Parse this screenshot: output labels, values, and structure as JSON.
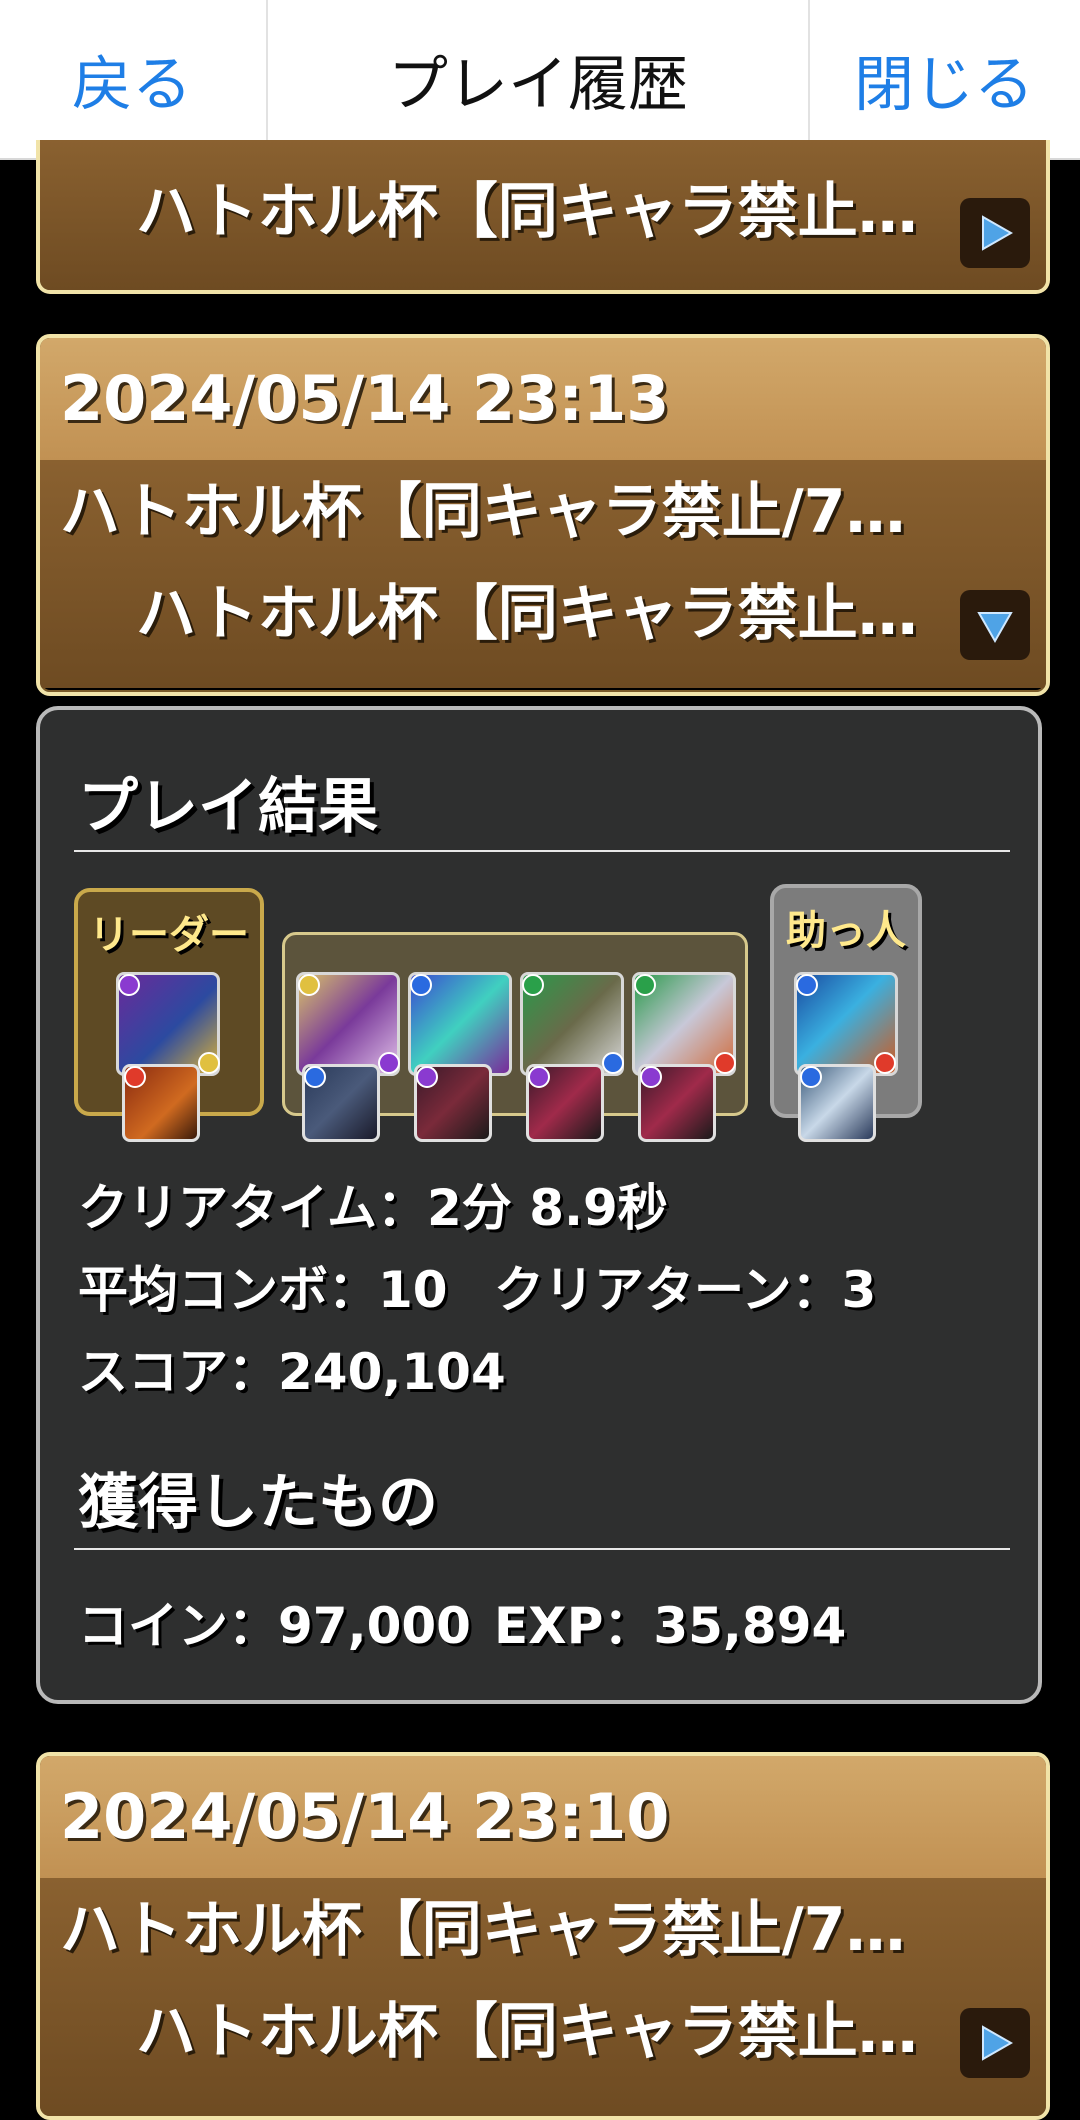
{
  "nav": {
    "back": "戻る",
    "title": "プレイ履歴",
    "close": "閉じる"
  },
  "entries": [
    {
      "subtitle": "ハトホル杯【同キャラ禁止…",
      "toggle": "expand-icon"
    },
    {
      "date": "2024/05/14 23:13",
      "title": "ハトホル杯【同キャラ禁止/7…",
      "subtitle": "ハトホル杯【同キャラ禁止…",
      "toggle": "collapse-icon"
    },
    {
      "date": "2024/05/14 23:10",
      "title": "ハトホル杯【同キャラ禁止/7…",
      "subtitle": "ハトホル杯【同キャラ禁止…",
      "toggle": "expand-icon"
    }
  ],
  "result": {
    "title": "プレイ結果",
    "leader_label": "リーダー",
    "helper_label": "助っ人",
    "clear_time": "クリアタイム：2分 8.9秒",
    "avg_combo": "平均コンボ：10",
    "clear_turns": "クリアターン：3",
    "score": "スコア：240,104"
  },
  "rewards": {
    "title": "獲得したもの",
    "coins": "コイン：97,000",
    "exp": "EXP：35,894"
  },
  "colors": {
    "link": "#1e7ee6",
    "entry_header": "#c8995b",
    "entry_body": "#7b5628",
    "panel": "#2e2f2f",
    "leader_label": "#ffe98c"
  }
}
